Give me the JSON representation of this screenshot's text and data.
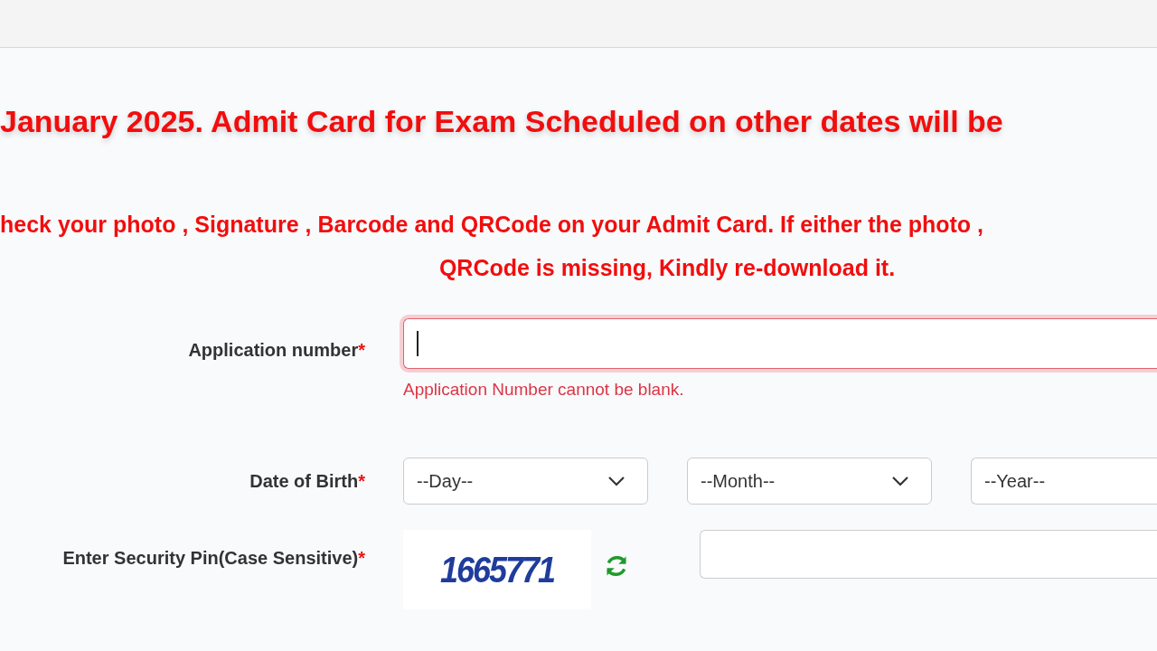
{
  "notice": {
    "headline": "January 2025. Admit Card for Exam Scheduled on other dates will be",
    "message_lines": [
      "heck your photo , Signature , Barcode and QRCode on your Admit Card. If either the photo ,",
      "QRCode is missing, Kindly re-download it."
    ]
  },
  "form": {
    "fields": [
      {
        "kind": "text",
        "label": "Application number",
        "required_mark": "*",
        "invalid": true,
        "focused": true,
        "error": "Application Number cannot be blank."
      },
      {
        "kind": "date",
        "label": "Date of Birth",
        "required_mark": "*",
        "selects": [
          {
            "value": "--Day--"
          },
          {
            "value": "--Month--"
          },
          {
            "value": "--Year--"
          }
        ]
      },
      {
        "kind": "captcha",
        "label": "Enter Security Pin(Case Sensitive)",
        "required_mark": "*",
        "captcha": "1665771"
      }
    ]
  }
}
